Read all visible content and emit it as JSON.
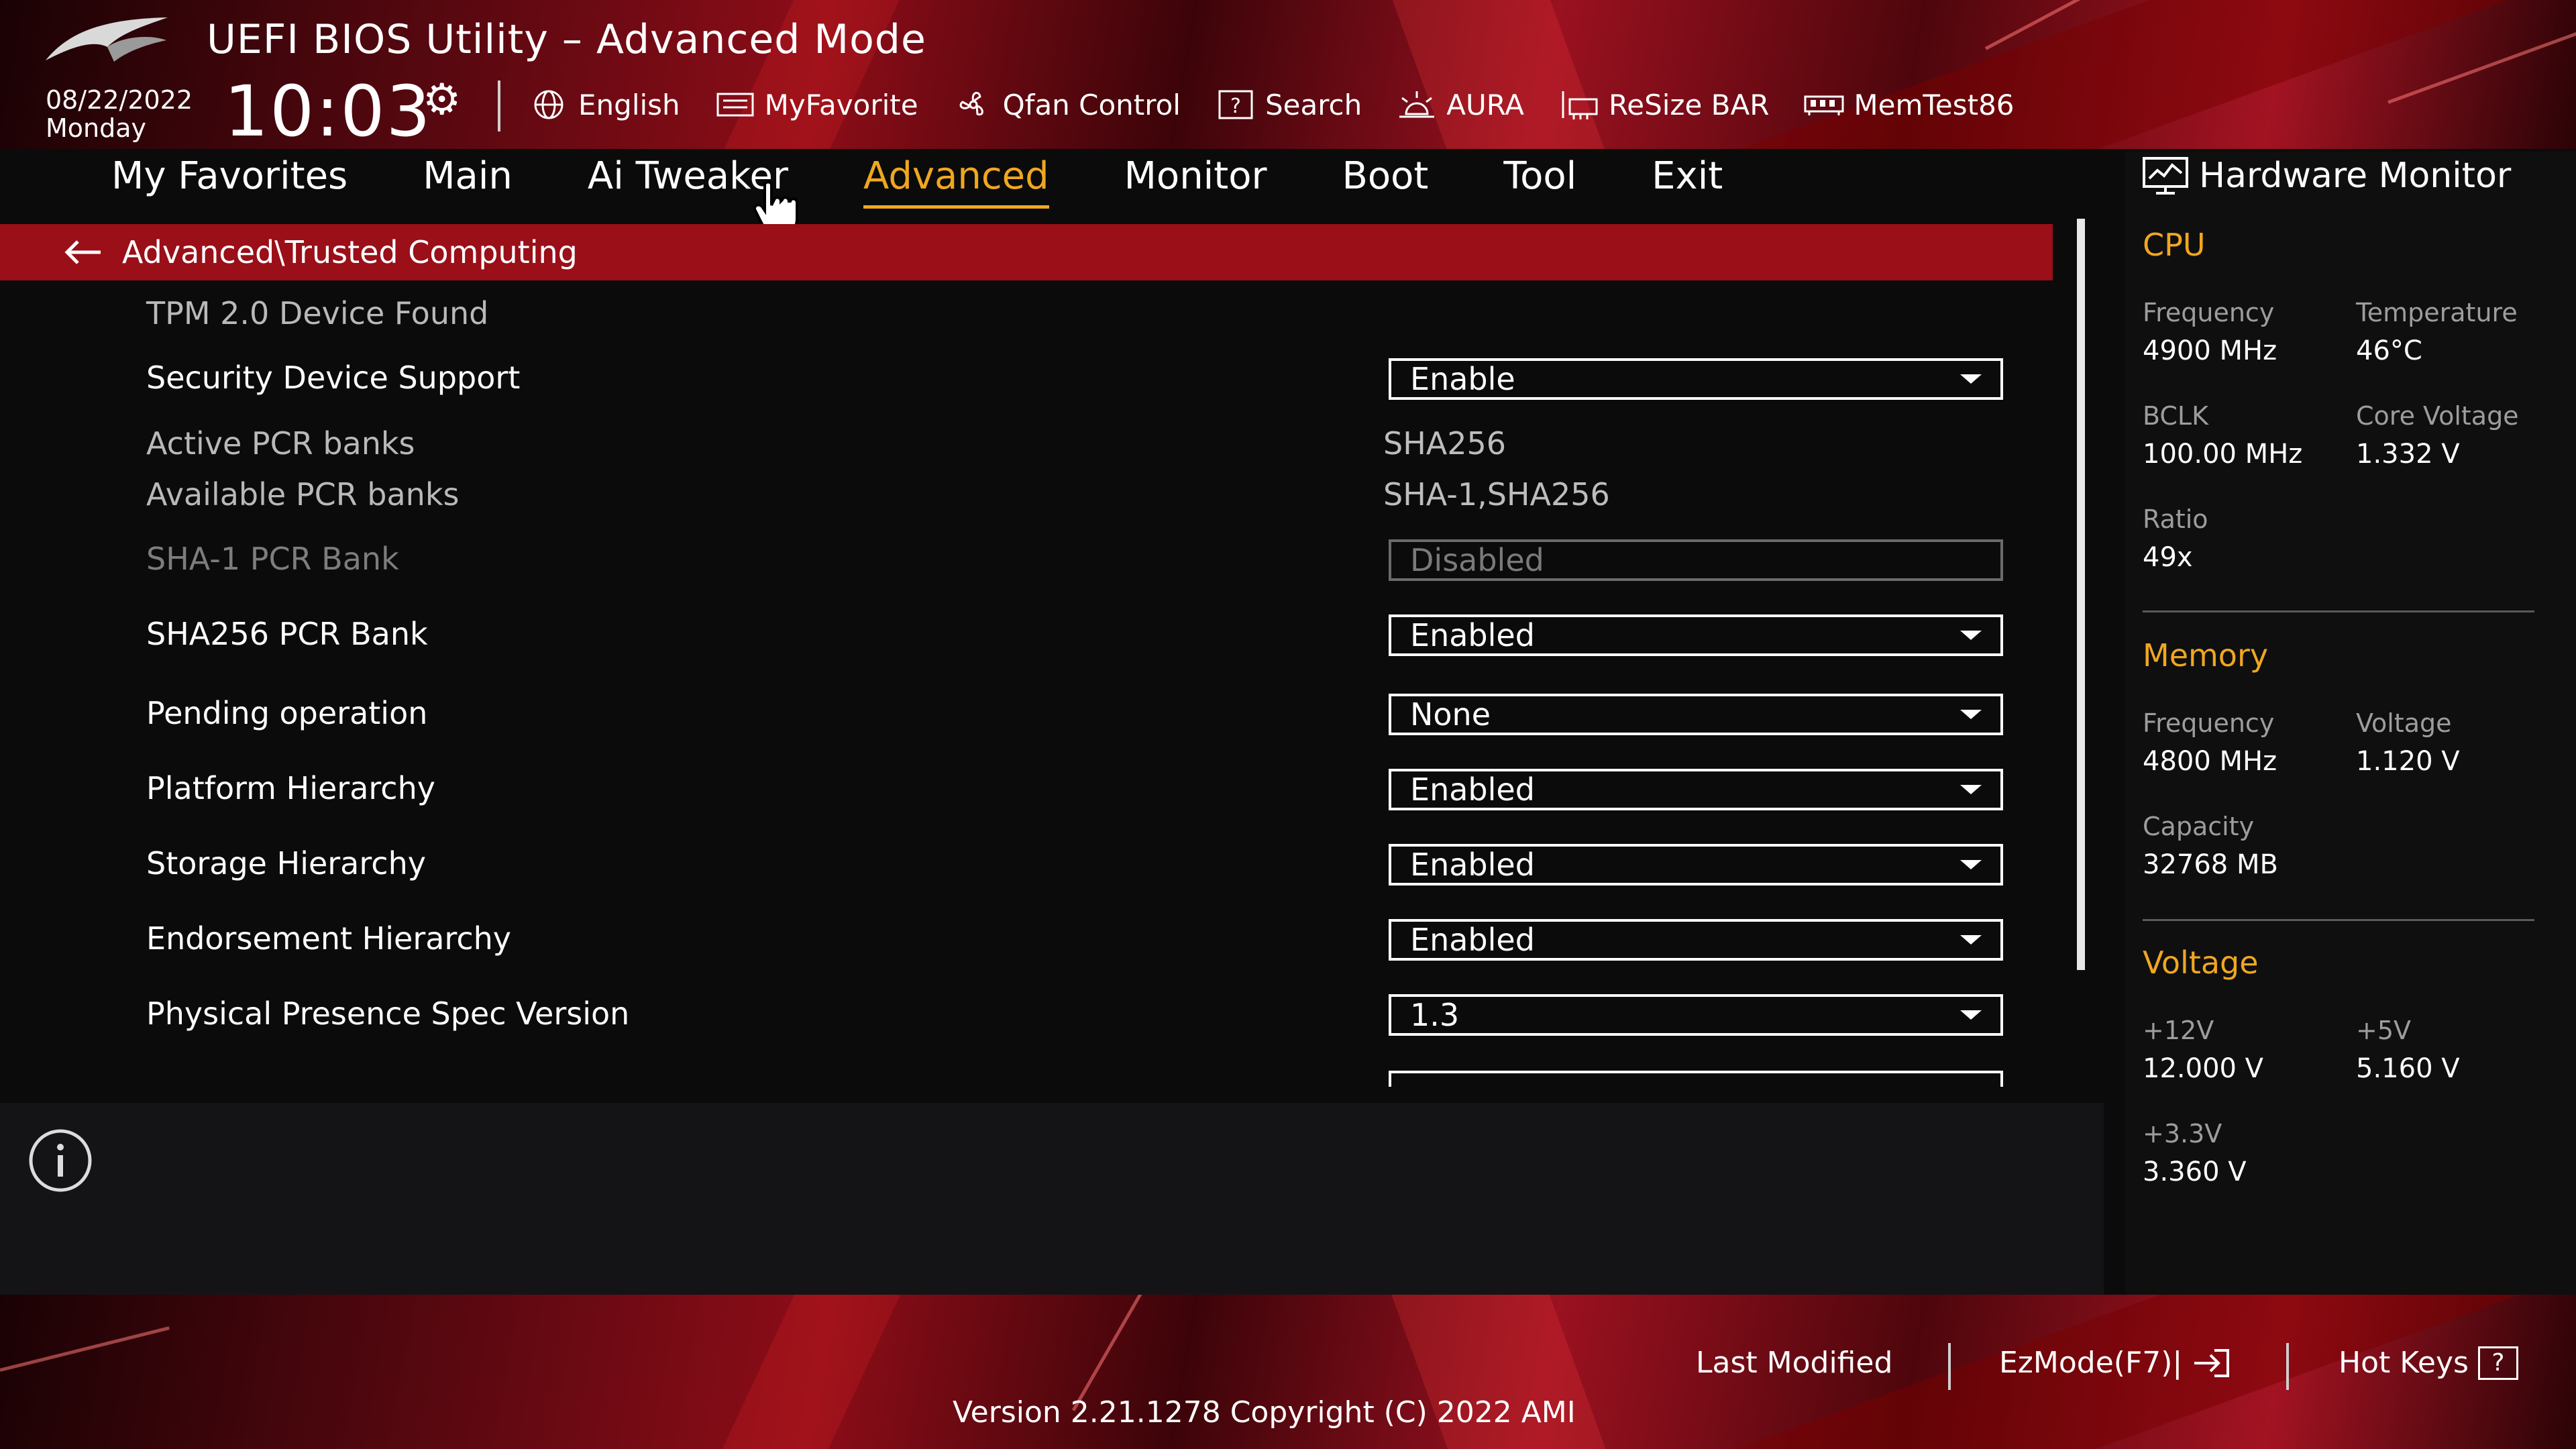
{
  "header": {
    "app_title": "UEFI BIOS Utility – Advanced Mode",
    "date": "08/22/2022",
    "day": "Monday",
    "time": "10:03",
    "tools": [
      {
        "icon": "globe-icon",
        "label": "English"
      },
      {
        "icon": "keyboard-icon",
        "label": "MyFavorite"
      },
      {
        "icon": "fan-icon",
        "label": "Qfan Control"
      },
      {
        "icon": "question-box-icon",
        "label": "Search"
      },
      {
        "icon": "light-icon",
        "label": "AURA"
      },
      {
        "icon": "resize-bar-icon",
        "label": "ReSize BAR"
      },
      {
        "icon": "memory-icon",
        "label": "MemTest86"
      }
    ]
  },
  "tabs": [
    {
      "label": "My Favorites"
    },
    {
      "label": "Main"
    },
    {
      "label": "Ai Tweaker"
    },
    {
      "label": "Advanced",
      "active": true
    },
    {
      "label": "Monitor"
    },
    {
      "label": "Boot"
    },
    {
      "label": "Tool"
    },
    {
      "label": "Exit"
    }
  ],
  "breadcrumb": "Advanced\\Trusted Computing",
  "settings": {
    "tpm_found": "TPM 2.0 Device Found",
    "security_device_support": {
      "label": "Security Device Support",
      "value": "Enable"
    },
    "active_pcr": {
      "label": "Active PCR banks",
      "value": "SHA256"
    },
    "available_pcr": {
      "label": "Available PCR banks",
      "value": "SHA-1,SHA256"
    },
    "sha1_pcr": {
      "label": "SHA-1 PCR Bank",
      "value": "Disabled"
    },
    "sha256_pcr": {
      "label": "SHA256 PCR Bank",
      "value": "Enabled"
    },
    "pending_op": {
      "label": "Pending operation",
      "value": "None"
    },
    "platform_hier": {
      "label": "Platform Hierarchy",
      "value": "Enabled"
    },
    "storage_hier": {
      "label": "Storage Hierarchy",
      "value": "Enabled"
    },
    "endorse_hier": {
      "label": "Endorsement Hierarchy",
      "value": "Enabled"
    },
    "pp_spec": {
      "label": "Physical Presence Spec Version",
      "value": "1.3"
    }
  },
  "hardware_monitor": {
    "title": "Hardware Monitor",
    "cpu": {
      "title": "CPU",
      "frequency_label": "Frequency",
      "frequency": "4900 MHz",
      "temperature_label": "Temperature",
      "temperature": "46°C",
      "bclk_label": "BCLK",
      "bclk": "100.00 MHz",
      "core_voltage_label": "Core Voltage",
      "core_voltage": "1.332 V",
      "ratio_label": "Ratio",
      "ratio": "49x"
    },
    "memory": {
      "title": "Memory",
      "frequency_label": "Frequency",
      "frequency": "4800 MHz",
      "voltage_label": "Voltage",
      "voltage": "1.120 V",
      "capacity_label": "Capacity",
      "capacity": "32768 MB"
    },
    "voltage": {
      "title": "Voltage",
      "v12_label": "+12V",
      "v12": "12.000 V",
      "v5_label": "+5V",
      "v5": "5.160 V",
      "v33_label": "+3.3V",
      "v33": "3.360 V"
    }
  },
  "footer": {
    "last_modified": "Last Modified",
    "ezmode": "EzMode(F7)|",
    "hotkeys": "Hot Keys",
    "hotkeys_key": "?",
    "version": "Version 2.21.1278 Copyright (C) 2022 AMI"
  },
  "colors": {
    "accent": "#f0a71f",
    "breadcrumb_bg": "#9a0f18"
  }
}
